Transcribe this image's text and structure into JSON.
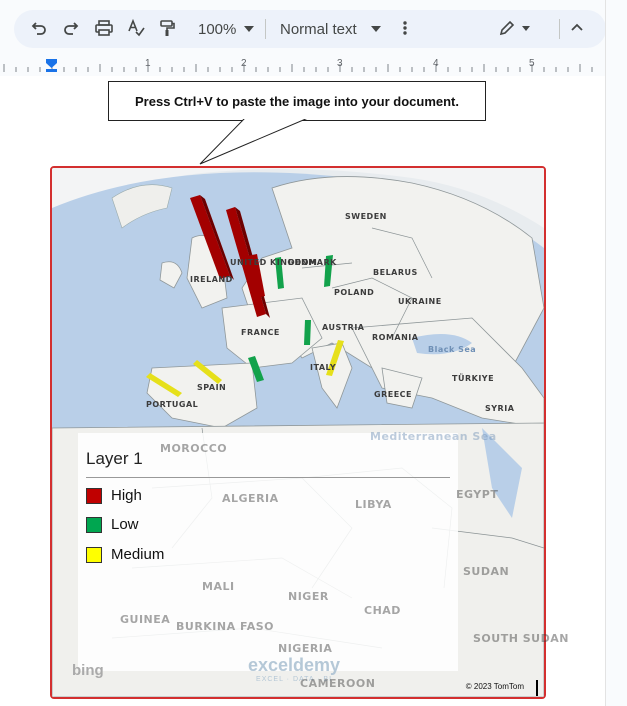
{
  "toolbar": {
    "zoom": "100%",
    "style": "Normal text"
  },
  "ruler": {
    "ticks": [
      "1",
      "2",
      "3",
      "4",
      "5"
    ]
  },
  "callout": {
    "text": "Press Ctrl+V to paste the image into your document."
  },
  "map": {
    "labels": [
      "IRELAND",
      "UNITED KINGDOM",
      "DENMARK",
      "SWEDEN",
      "BELARUS",
      "POLAND",
      "UKRAINE",
      "FRANCE",
      "AUSTRIA",
      "ROMANIA",
      "Black Sea",
      "ITALY",
      "SPAIN",
      "PORTUGAL",
      "GREECE",
      "TÜRKIYE",
      "SYRIA",
      "MOROCCO",
      "ALGERIA",
      "LIBYA",
      "EGYPT",
      "MALI",
      "NIGER",
      "CHAD",
      "SUDAN",
      "SOUTH SUDAN",
      "BURKINA FASO",
      "NIGERIA",
      "CAMEROON",
      "GUINEA",
      "Mediterranean Sea"
    ],
    "legend": {
      "title": "Layer 1",
      "items": [
        {
          "label": "High",
          "color": "#c00000"
        },
        {
          "label": "Low",
          "color": "#00a650"
        },
        {
          "label": "Medium",
          "color": "#ffff00"
        }
      ]
    },
    "attribution": "© 2023 TomTom",
    "bing": "bing",
    "watermark": "exceldemy",
    "watermark_sub": "EXCEL · DATA · BI"
  },
  "colors": {
    "high": "#a30000",
    "low": "#12a24b",
    "medium": "#e6e01a",
    "frame": "#d32f2f"
  }
}
